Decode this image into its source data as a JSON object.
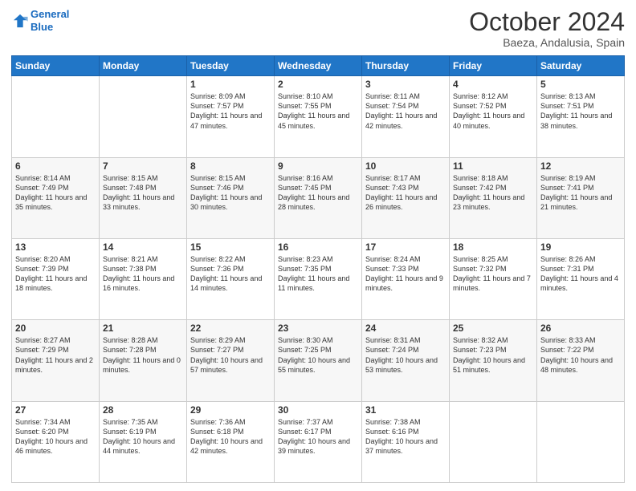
{
  "header": {
    "logo_line1": "General",
    "logo_line2": "Blue",
    "month": "October 2024",
    "location": "Baeza, Andalusia, Spain"
  },
  "weekdays": [
    "Sunday",
    "Monday",
    "Tuesday",
    "Wednesday",
    "Thursday",
    "Friday",
    "Saturday"
  ],
  "weeks": [
    [
      {
        "day": "",
        "info": ""
      },
      {
        "day": "",
        "info": ""
      },
      {
        "day": "1",
        "info": "Sunrise: 8:09 AM\nSunset: 7:57 PM\nDaylight: 11 hours and 47 minutes."
      },
      {
        "day": "2",
        "info": "Sunrise: 8:10 AM\nSunset: 7:55 PM\nDaylight: 11 hours and 45 minutes."
      },
      {
        "day": "3",
        "info": "Sunrise: 8:11 AM\nSunset: 7:54 PM\nDaylight: 11 hours and 42 minutes."
      },
      {
        "day": "4",
        "info": "Sunrise: 8:12 AM\nSunset: 7:52 PM\nDaylight: 11 hours and 40 minutes."
      },
      {
        "day": "5",
        "info": "Sunrise: 8:13 AM\nSunset: 7:51 PM\nDaylight: 11 hours and 38 minutes."
      }
    ],
    [
      {
        "day": "6",
        "info": "Sunrise: 8:14 AM\nSunset: 7:49 PM\nDaylight: 11 hours and 35 minutes."
      },
      {
        "day": "7",
        "info": "Sunrise: 8:15 AM\nSunset: 7:48 PM\nDaylight: 11 hours and 33 minutes."
      },
      {
        "day": "8",
        "info": "Sunrise: 8:15 AM\nSunset: 7:46 PM\nDaylight: 11 hours and 30 minutes."
      },
      {
        "day": "9",
        "info": "Sunrise: 8:16 AM\nSunset: 7:45 PM\nDaylight: 11 hours and 28 minutes."
      },
      {
        "day": "10",
        "info": "Sunrise: 8:17 AM\nSunset: 7:43 PM\nDaylight: 11 hours and 26 minutes."
      },
      {
        "day": "11",
        "info": "Sunrise: 8:18 AM\nSunset: 7:42 PM\nDaylight: 11 hours and 23 minutes."
      },
      {
        "day": "12",
        "info": "Sunrise: 8:19 AM\nSunset: 7:41 PM\nDaylight: 11 hours and 21 minutes."
      }
    ],
    [
      {
        "day": "13",
        "info": "Sunrise: 8:20 AM\nSunset: 7:39 PM\nDaylight: 11 hours and 18 minutes."
      },
      {
        "day": "14",
        "info": "Sunrise: 8:21 AM\nSunset: 7:38 PM\nDaylight: 11 hours and 16 minutes."
      },
      {
        "day": "15",
        "info": "Sunrise: 8:22 AM\nSunset: 7:36 PM\nDaylight: 11 hours and 14 minutes."
      },
      {
        "day": "16",
        "info": "Sunrise: 8:23 AM\nSunset: 7:35 PM\nDaylight: 11 hours and 11 minutes."
      },
      {
        "day": "17",
        "info": "Sunrise: 8:24 AM\nSunset: 7:33 PM\nDaylight: 11 hours and 9 minutes."
      },
      {
        "day": "18",
        "info": "Sunrise: 8:25 AM\nSunset: 7:32 PM\nDaylight: 11 hours and 7 minutes."
      },
      {
        "day": "19",
        "info": "Sunrise: 8:26 AM\nSunset: 7:31 PM\nDaylight: 11 hours and 4 minutes."
      }
    ],
    [
      {
        "day": "20",
        "info": "Sunrise: 8:27 AM\nSunset: 7:29 PM\nDaylight: 11 hours and 2 minutes."
      },
      {
        "day": "21",
        "info": "Sunrise: 8:28 AM\nSunset: 7:28 PM\nDaylight: 11 hours and 0 minutes."
      },
      {
        "day": "22",
        "info": "Sunrise: 8:29 AM\nSunset: 7:27 PM\nDaylight: 10 hours and 57 minutes."
      },
      {
        "day": "23",
        "info": "Sunrise: 8:30 AM\nSunset: 7:25 PM\nDaylight: 10 hours and 55 minutes."
      },
      {
        "day": "24",
        "info": "Sunrise: 8:31 AM\nSunset: 7:24 PM\nDaylight: 10 hours and 53 minutes."
      },
      {
        "day": "25",
        "info": "Sunrise: 8:32 AM\nSunset: 7:23 PM\nDaylight: 10 hours and 51 minutes."
      },
      {
        "day": "26",
        "info": "Sunrise: 8:33 AM\nSunset: 7:22 PM\nDaylight: 10 hours and 48 minutes."
      }
    ],
    [
      {
        "day": "27",
        "info": "Sunrise: 7:34 AM\nSunset: 6:20 PM\nDaylight: 10 hours and 46 minutes."
      },
      {
        "day": "28",
        "info": "Sunrise: 7:35 AM\nSunset: 6:19 PM\nDaylight: 10 hours and 44 minutes."
      },
      {
        "day": "29",
        "info": "Sunrise: 7:36 AM\nSunset: 6:18 PM\nDaylight: 10 hours and 42 minutes."
      },
      {
        "day": "30",
        "info": "Sunrise: 7:37 AM\nSunset: 6:17 PM\nDaylight: 10 hours and 39 minutes."
      },
      {
        "day": "31",
        "info": "Sunrise: 7:38 AM\nSunset: 6:16 PM\nDaylight: 10 hours and 37 minutes."
      },
      {
        "day": "",
        "info": ""
      },
      {
        "day": "",
        "info": ""
      }
    ]
  ]
}
